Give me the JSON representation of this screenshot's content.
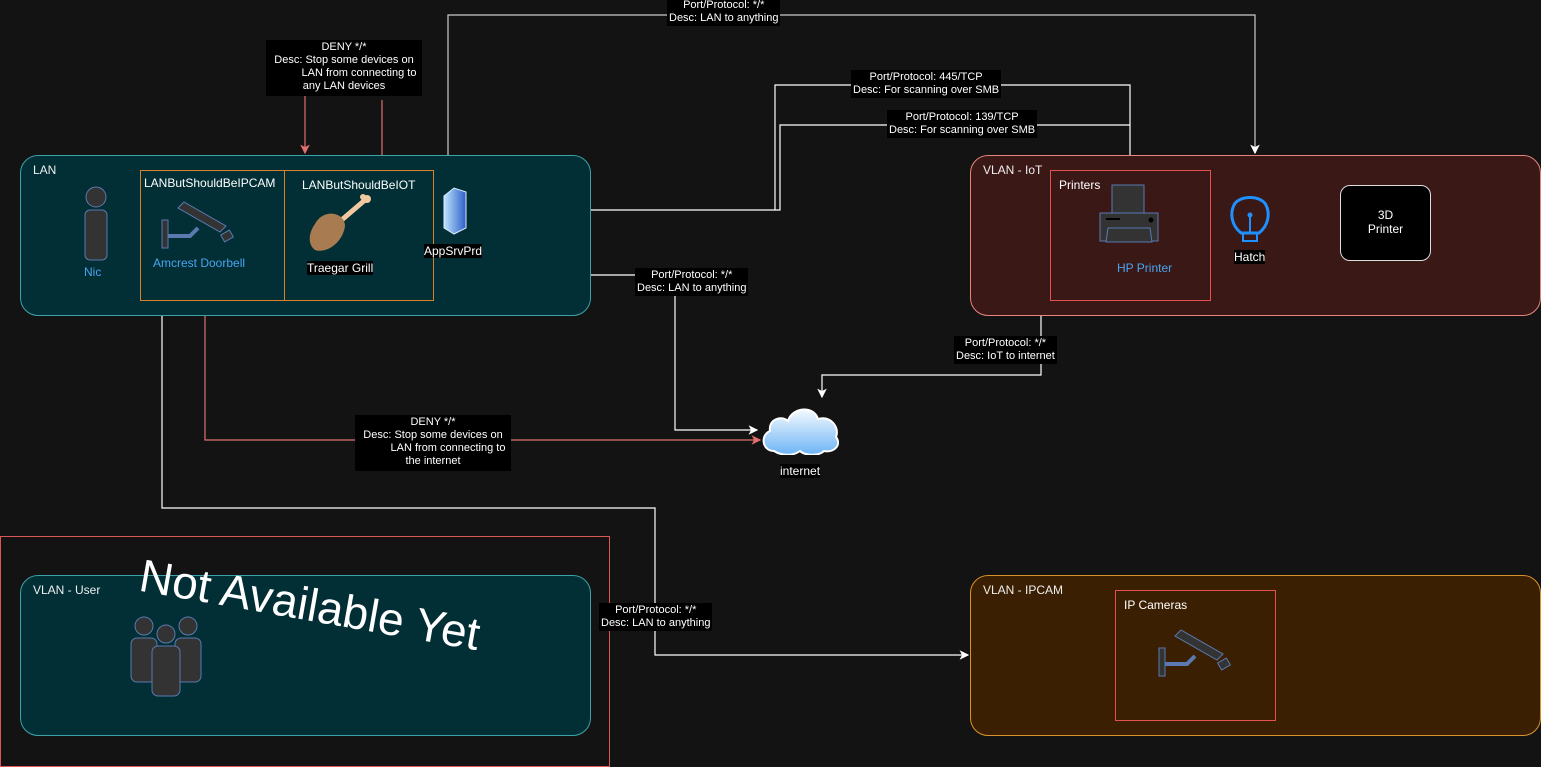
{
  "zones": {
    "lan": {
      "title": "LAN"
    },
    "iot": {
      "title": "VLAN - IoT"
    },
    "user": {
      "title": "VLAN - User"
    },
    "ipcam": {
      "title": "VLAN - IPCAM"
    }
  },
  "groups": {
    "lan_ipcam": "LANButShouldBeIPCAM",
    "lan_iot": "LANButShouldBeIOT",
    "printers": "Printers",
    "ip_cameras": "IP Cameras"
  },
  "nodes": {
    "nic": "Nic",
    "doorbell": "Amcrest Doorbell",
    "grill": "Traegar Grill",
    "appsrv": "AppSrvPrd",
    "hp_printer": "HP Printer",
    "hatch": "Hatch",
    "printer3d_line1": "3D",
    "printer3d_line2": "Printer",
    "internet": "internet"
  },
  "watermark": "Not Available Yet",
  "edge_labels": {
    "lan_to_iot": {
      "l1": "Port/Protocol: */*",
      "l2": "Desc: LAN to anything"
    },
    "deny_lan": {
      "l1": "DENY */*",
      "l2": "Desc: Stop some devices on",
      "l3": "LAN from connecting to",
      "l4": "any LAN devices"
    },
    "smb445": {
      "l1": "Port/Protocol: 445/TCP",
      "l2": "Desc: For scanning over SMB"
    },
    "smb139": {
      "l1": "Port/Protocol: 139/TCP",
      "l2": "Desc: For scanning over SMB"
    },
    "lan_to_internet": {
      "l1": "Port/Protocol: */*",
      "l2": "Desc: LAN to anything"
    },
    "iot_to_internet": {
      "l1": "Port/Protocol: */*",
      "l2": "Desc: IoT to internet"
    },
    "deny_internet": {
      "l1": "DENY */*",
      "l2": "Desc: Stop some devices on",
      "l3": "LAN from connecting to",
      "l4": "the internet"
    },
    "lan_to_ipcam": {
      "l1": "Port/Protocol: */*",
      "l2": "Desc: LAN to anything"
    }
  },
  "colors": {
    "lan_fill": "#022f35",
    "lan_stroke": "#3aa3aa",
    "iot_fill": "#3a1816",
    "iot_stroke": "#e8857a",
    "ipcam_fill": "#3b1f02",
    "ipcam_stroke": "#d9922b",
    "deny_line": "#e07070",
    "allow_line": "#ffffff",
    "accent_text": "#4aa3f0"
  }
}
